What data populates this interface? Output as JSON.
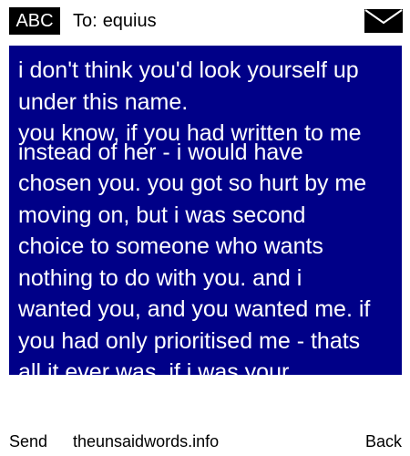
{
  "header": {
    "mode_label": "ABC",
    "to_label": "To:",
    "recipient": "equius",
    "envelope_icon": "envelope-icon"
  },
  "message": {
    "background_color": "#000088",
    "text_color": "#ffffff",
    "lines": [
      "i don't think you'd look yourself up",
      "under this name.",
      "you know, if you had written to me",
      "instead of her - i would have",
      "chosen you. you got so hurt by me",
      "moving on, but i was second",
      "choice to someone who wants",
      "nothing to do with you. and i",
      "wanted you, and you wanted me. if",
      "you had only prioritised me - thats",
      "all it ever was. if i was your"
    ]
  },
  "softkeys": {
    "left": "Send",
    "center": "theunsaidwords.info",
    "right": "Back"
  }
}
